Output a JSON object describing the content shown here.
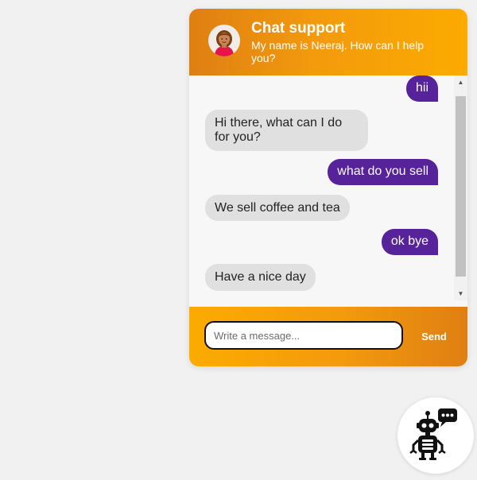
{
  "header": {
    "title": "Chat support",
    "subtitle": "My name is Neeraj. How can I help you?",
    "avatar_icon": "agent-avatar-icon"
  },
  "messages": [
    {
      "sender": "user",
      "text": "hii"
    },
    {
      "sender": "bot",
      "text": "Hi there, what can I do for you?"
    },
    {
      "sender": "user",
      "text": "what do you sell"
    },
    {
      "sender": "bot",
      "text": "We sell coffee and tea"
    },
    {
      "sender": "user",
      "text": "ok bye"
    },
    {
      "sender": "bot",
      "text": "Have a nice day"
    }
  ],
  "composer": {
    "placeholder": "Write a message...",
    "value": "",
    "send_label": "Send"
  },
  "launcher": {
    "icon": "chatbot-icon"
  },
  "colors": {
    "header_gradient": [
      "#df7f12",
      "#fcab00"
    ],
    "user_bubble": "#57239a",
    "bot_bubble": "#e0e0e0",
    "page_background": "#f1f1f1"
  }
}
